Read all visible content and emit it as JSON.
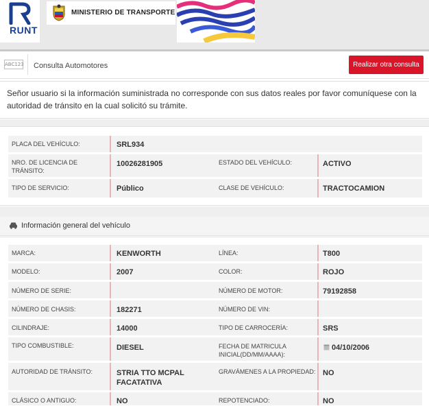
{
  "brand": {
    "runt": "RUNT",
    "ministry": "MINISTERIO DE TRANSPORTE"
  },
  "header": {
    "abc": "ABC123",
    "title": "Consulta Automotores",
    "button": "Realizar otra consulta"
  },
  "notice": "Señor usuario si la información suministrada no corresponde con sus datos reales por favor comuníquese con la autoridad de tránsito en la cual solicitó su trámite.",
  "summary": {
    "placa_label": "PLACA DEL VEHÍCULO:",
    "placa": "SRL934",
    "licencia_label": "NRO. DE LICENCIA DE TRÁNSITO:",
    "licencia": "10026281905",
    "estado_label": "ESTADO DEL VEHÍCULO:",
    "estado": "ACTIVO",
    "servicio_label": "TIPO DE SERVICIO:",
    "servicio": "Público",
    "clase_label": "CLASE DE VEHÍCULO:",
    "clase": "TRACTOCAMION"
  },
  "general": {
    "title": "Información general del vehículo",
    "marca_label": "MARCA:",
    "marca": "KENWORTH",
    "linea_label": "LÍNEA:",
    "linea": "T800",
    "modelo_label": "MODELO:",
    "modelo": "2007",
    "color_label": "COLOR:",
    "color": "ROJO",
    "serie_label": "NÚMERO DE SERIE:",
    "serie": "",
    "motor_label": "NÚMERO DE MOTOR:",
    "motor": "79192858",
    "chasis_label": "NÚMERO DE CHASIS:",
    "chasis": "182271",
    "vin_label": "NÚMERO DE VIN:",
    "vin": "",
    "cilindraje_label": "CILINDRAJE:",
    "cilindraje": "14000",
    "carroceria_label": "TIPO DE CARROCERÍA:",
    "carroceria": "SRS",
    "combustible_label": "TIPO COMBUSTIBLE:",
    "combustible": "DIESEL",
    "matricula_label_1": "FECHA DE MATRICULA",
    "matricula_label_2": "INICIAL(DD/MM/AAAA):",
    "matricula": "04/10/2006",
    "autoridad_label": "AUTORIDAD DE TRÁNSITO:",
    "autoridad_1": "STRIA TTO MCPAL",
    "autoridad_2": "FACATATIVA",
    "gravamenes_label": "GRAVÁMENES A LA PROPIEDAD:",
    "gravamenes": "NO",
    "clasico_label": "CLÁSICO O ANTIGUO:",
    "clasico": "NO",
    "repotenciado_label": "REPOTENCIADO:",
    "repotenciado": "NO"
  },
  "colors": {
    "accent": "#d9152a",
    "runt_blue": "#1b3f8f",
    "row_bg": "#f2f2f2",
    "bar": "#e8b4b8"
  }
}
